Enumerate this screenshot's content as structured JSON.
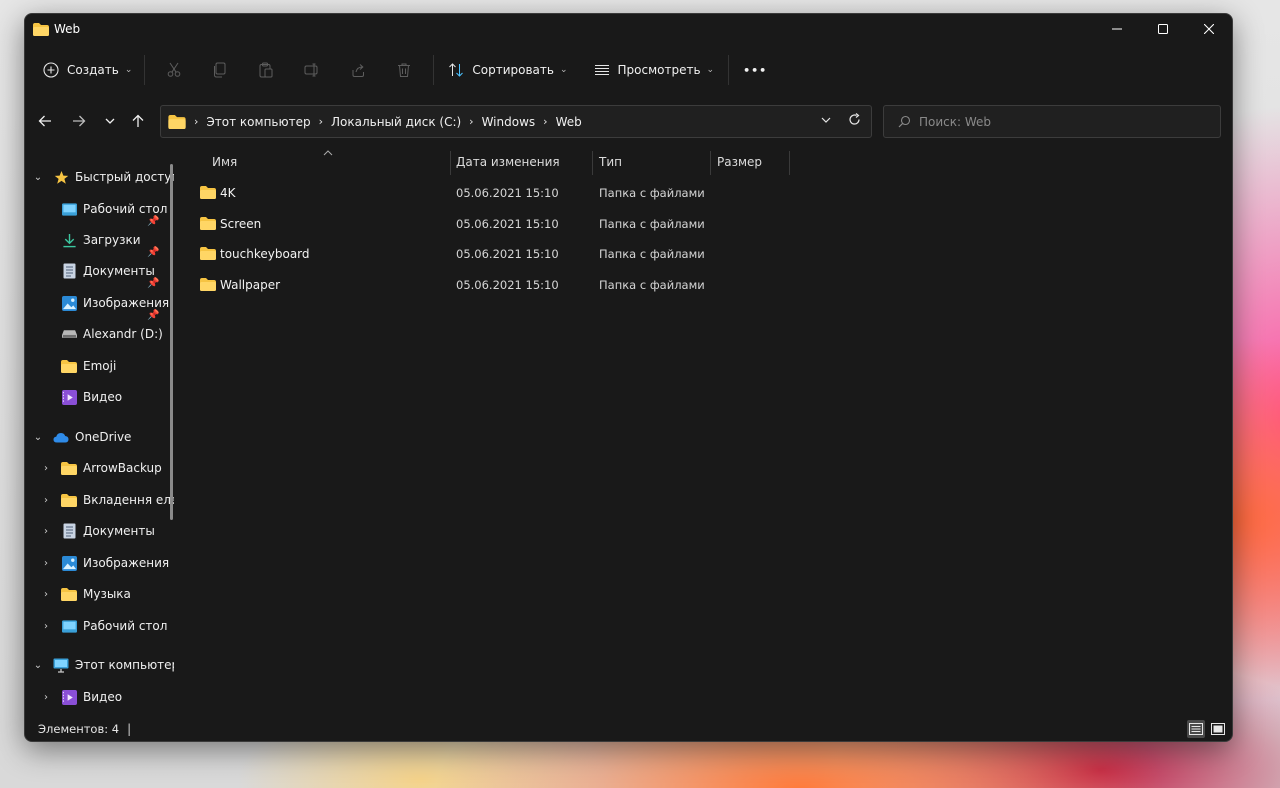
{
  "window": {
    "title": "Web"
  },
  "toolbar": {
    "new_label": "Создать",
    "sort_label": "Сортировать",
    "view_label": "Просмотреть",
    "more_label": "•••"
  },
  "address": {
    "crumbs": [
      "Этот компьютер",
      "Локальный диск (C:)",
      "Windows",
      "Web"
    ]
  },
  "search": {
    "placeholder": "Поиск: Web"
  },
  "sidebar": {
    "quick_access": {
      "label": "Быстрый доступ",
      "items": [
        {
          "label": "Рабочий стол",
          "icon": "desktop-icon",
          "pinned": true
        },
        {
          "label": "Загрузки",
          "icon": "download-icon",
          "pinned": true
        },
        {
          "label": "Документы",
          "icon": "documents-icon",
          "pinned": true
        },
        {
          "label": "Изображения",
          "icon": "pictures-icon",
          "pinned": true
        },
        {
          "label": "Alexandr (D:)",
          "icon": "drive-icon",
          "pinned": false
        },
        {
          "label": "Emoji",
          "icon": "folder-icon",
          "pinned": false
        },
        {
          "label": "Видео",
          "icon": "video-icon",
          "pinned": false
        }
      ]
    },
    "onedrive": {
      "label": "OneDrive",
      "items": [
        {
          "label": "ArrowBackup",
          "icon": "folder-icon"
        },
        {
          "label": "Вкладення електронної пошти",
          "icon": "folder-icon"
        },
        {
          "label": "Документы",
          "icon": "documents-icon"
        },
        {
          "label": "Изображения",
          "icon": "pictures-icon"
        },
        {
          "label": "Музыка",
          "icon": "folder-icon"
        },
        {
          "label": "Рабочий стол",
          "icon": "desktop-icon"
        }
      ]
    },
    "this_pc": {
      "label": "Этот компьютер",
      "items": [
        {
          "label": "Видео",
          "icon": "video-icon"
        }
      ]
    }
  },
  "columns": {
    "name": "Имя",
    "date": "Дата изменения",
    "type": "Тип",
    "size": "Размер"
  },
  "files": [
    {
      "name": "4K",
      "date": "05.06.2021 15:10",
      "type": "Папка с файлами"
    },
    {
      "name": "Screen",
      "date": "05.06.2021 15:10",
      "type": "Папка с файлами"
    },
    {
      "name": "touchkeyboard",
      "date": "05.06.2021 15:10",
      "type": "Папка с файлами"
    },
    {
      "name": "Wallpaper",
      "date": "05.06.2021 15:10",
      "type": "Папка с файлами"
    }
  ],
  "status": {
    "items_text": "Элементов: 4"
  },
  "colors": {
    "folder": "#f6c443",
    "accent": "#4cc2ff",
    "window_bg": "#191919"
  }
}
